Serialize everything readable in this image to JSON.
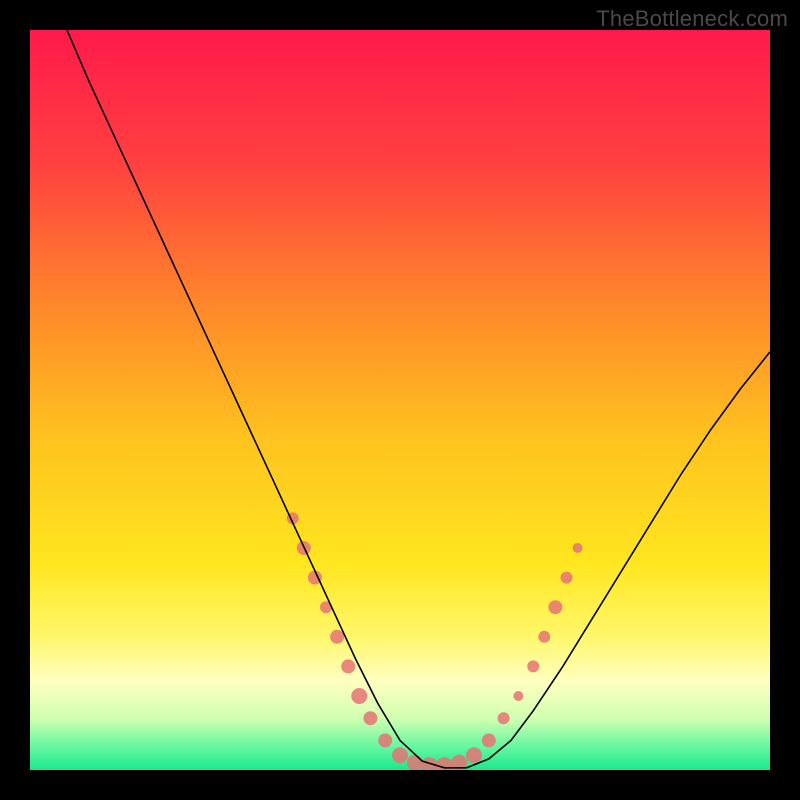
{
  "watermark": "TheBottleneck.com",
  "chart_data": {
    "type": "line",
    "title": "",
    "xlabel": "",
    "ylabel": "",
    "xlim": [
      0,
      100
    ],
    "ylim": [
      0,
      100
    ],
    "grid": false,
    "legend": false,
    "background_gradient": {
      "stops": [
        {
          "offset": 0.0,
          "color": "#ff1a4b"
        },
        {
          "offset": 0.18,
          "color": "#ff4040"
        },
        {
          "offset": 0.38,
          "color": "#ff8a2a"
        },
        {
          "offset": 0.55,
          "color": "#ffc21f"
        },
        {
          "offset": 0.72,
          "color": "#ffe61f"
        },
        {
          "offset": 0.82,
          "color": "#fff76b"
        },
        {
          "offset": 0.88,
          "color": "#ffffc0"
        },
        {
          "offset": 0.93,
          "color": "#d0ffb0"
        },
        {
          "offset": 0.97,
          "color": "#62f7a0"
        },
        {
          "offset": 1.0,
          "color": "#18e98f"
        }
      ]
    },
    "series": [
      {
        "name": "curve",
        "color": "#000000",
        "width": 1.6,
        "x": [
          5,
          8,
          11,
          14,
          17,
          20,
          23,
          26,
          29,
          32,
          35,
          38,
          41,
          44,
          47,
          50,
          53,
          56,
          59,
          62,
          65,
          68,
          72,
          76,
          80,
          84,
          88,
          92,
          96,
          100
        ],
        "y": [
          100,
          93,
          86.5,
          80,
          73.5,
          67,
          60.5,
          54,
          47.5,
          41,
          34.5,
          28,
          21.5,
          15,
          9,
          4,
          1.2,
          0.3,
          0.3,
          1.5,
          4,
          8,
          14,
          20.5,
          27,
          33.5,
          40,
          46,
          51.5,
          56.5
        ]
      }
    ],
    "markers": {
      "name": "dense-points",
      "color": "#e57373",
      "radius_range": [
        4,
        10
      ],
      "points": [
        {
          "x": 35.5,
          "y": 34,
          "r": 6
        },
        {
          "x": 37.0,
          "y": 30,
          "r": 7
        },
        {
          "x": 38.5,
          "y": 26,
          "r": 7
        },
        {
          "x": 40.0,
          "y": 22,
          "r": 6
        },
        {
          "x": 41.5,
          "y": 18,
          "r": 7
        },
        {
          "x": 43.0,
          "y": 14,
          "r": 7
        },
        {
          "x": 44.5,
          "y": 10,
          "r": 8
        },
        {
          "x": 46.0,
          "y": 7,
          "r": 7
        },
        {
          "x": 48.0,
          "y": 4,
          "r": 7
        },
        {
          "x": 50.0,
          "y": 2,
          "r": 8
        },
        {
          "x": 52.0,
          "y": 1,
          "r": 8
        },
        {
          "x": 54.0,
          "y": 0.5,
          "r": 9
        },
        {
          "x": 56.0,
          "y": 0.5,
          "r": 9
        },
        {
          "x": 58.0,
          "y": 1,
          "r": 8
        },
        {
          "x": 60.0,
          "y": 2,
          "r": 8
        },
        {
          "x": 62.0,
          "y": 4,
          "r": 7
        },
        {
          "x": 64.0,
          "y": 7,
          "r": 6
        },
        {
          "x": 66.0,
          "y": 10,
          "r": 5
        },
        {
          "x": 68.0,
          "y": 14,
          "r": 6
        },
        {
          "x": 69.5,
          "y": 18,
          "r": 6
        },
        {
          "x": 71.0,
          "y": 22,
          "r": 7
        },
        {
          "x": 72.5,
          "y": 26,
          "r": 6
        },
        {
          "x": 74.0,
          "y": 30,
          "r": 5
        }
      ]
    }
  }
}
